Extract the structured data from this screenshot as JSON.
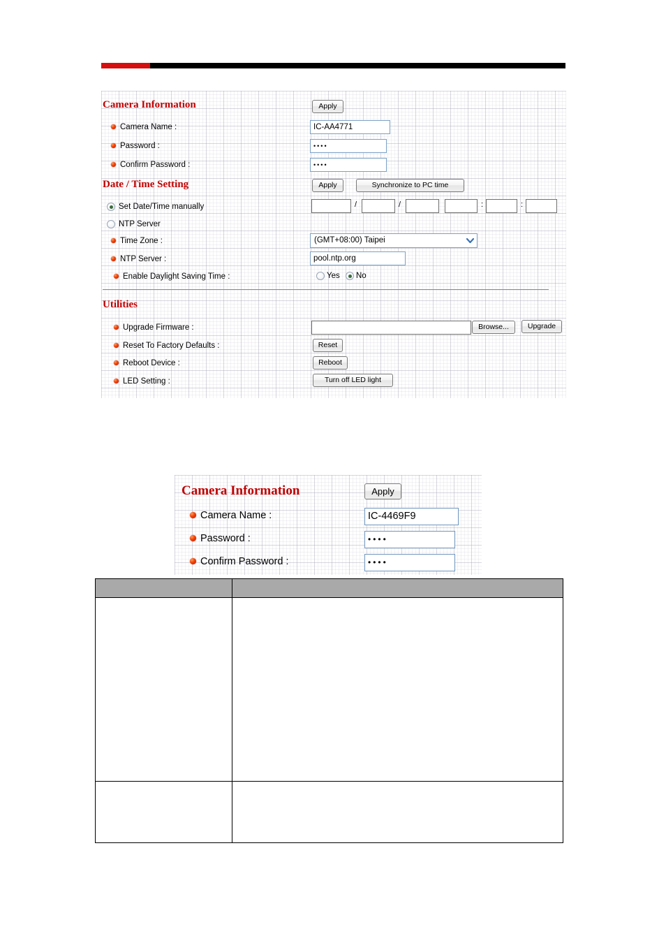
{
  "document": {
    "rule_accent_color": "#d50f0f",
    "rule_color": "#000000"
  },
  "panel_main": {
    "sections": [
      {
        "id": "camera-information",
        "title": "Camera Information",
        "apply_label": "Apply",
        "fields": [
          {
            "label": "Camera Name :",
            "value": "IC-AA4771",
            "type": "text"
          },
          {
            "label": "Password :",
            "value": "••••",
            "type": "password"
          },
          {
            "label": "Confirm Password :",
            "value": "••••",
            "type": "password"
          }
        ]
      },
      {
        "id": "date-time-setting",
        "title": "Date / Time Setting",
        "apply_label": "Apply",
        "sync_label": "Synchronize to PC time",
        "mode_options": [
          {
            "label": "Set Date/Time manually",
            "selected": true
          },
          {
            "label": "NTP Server",
            "selected": false
          }
        ],
        "date_parts": [
          "",
          "",
          ""
        ],
        "time_parts": [
          "",
          "",
          ""
        ],
        "date_separator": "/",
        "time_separator": ":",
        "timezone_label": "Time Zone :",
        "timezone_value": "(GMT+08:00) Taipei",
        "ntp_label": "NTP Server :",
        "ntp_value": "pool.ntp.org",
        "dst_label": "Enable Daylight Saving Time :",
        "dst_options": [
          {
            "label": "Yes",
            "selected": false
          },
          {
            "label": "No",
            "selected": true
          }
        ]
      },
      {
        "id": "utilities",
        "title": "Utilities",
        "rows": [
          {
            "label": "Upgrade Firmware :",
            "input_value": "",
            "browse_label": "Browse...",
            "action_label": "Upgrade"
          },
          {
            "label": "Reset To Factory Defaults :",
            "action_label": "Reset"
          },
          {
            "label": "Reboot Device :",
            "action_label": "Reboot"
          },
          {
            "label": "LED Setting :",
            "action_label": "Turn off LED light"
          }
        ]
      }
    ]
  },
  "panel_second": {
    "title": "Camera Information",
    "apply_label": "Apply",
    "fields": [
      {
        "label": "Camera Name :",
        "value": "IC-4469F9",
        "type": "text"
      },
      {
        "label": "Password :",
        "value": "••••",
        "type": "password"
      },
      {
        "label": "Confirm Password :",
        "value": "••••",
        "type": "password"
      }
    ]
  },
  "description_table": {
    "header": [
      "",
      ""
    ],
    "rows": [
      [
        "",
        ""
      ],
      [
        "",
        ""
      ]
    ]
  }
}
